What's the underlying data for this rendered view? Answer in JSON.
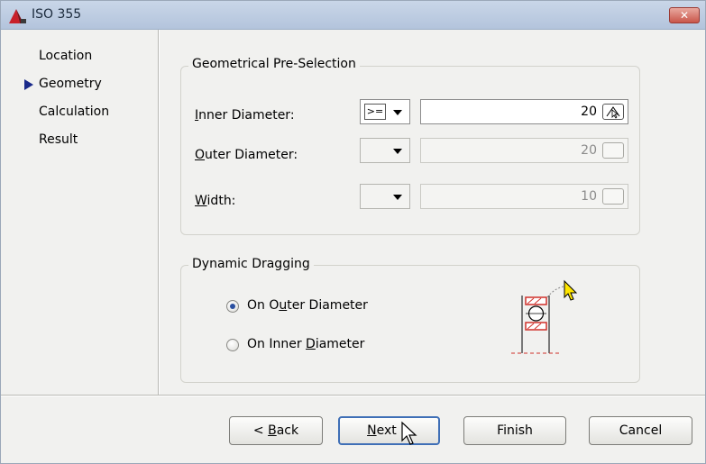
{
  "window": {
    "title": "ISO 355",
    "close_icon": "close-icon"
  },
  "nav": {
    "items": [
      "Location",
      "Geometry",
      "Calculation",
      "Result"
    ],
    "current_index": 1
  },
  "geometry_group": {
    "title": "Geometrical Pre-Selection",
    "rows": [
      {
        "label": "Inner Diameter:",
        "accel": "I",
        "rest": "nner Diameter:",
        "operator": ">=",
        "value": "20",
        "enabled": true
      },
      {
        "label": "Outer Diameter:",
        "accel": "O",
        "rest": "uter Diameter:",
        "operator": "",
        "value": "20",
        "enabled": false
      },
      {
        "label": "Width:",
        "accel": "W",
        "rest": "idth:",
        "operator": "",
        "value": "10",
        "enabled": false
      }
    ]
  },
  "dragging_group": {
    "title": "Dynamic Dragging",
    "options": [
      {
        "label": "On Outer Diameter",
        "pre": "On O",
        "accel": "u",
        "post": "ter Diameter",
        "selected": true
      },
      {
        "label": "On Inner Diameter",
        "pre": "On Inner ",
        "accel": "D",
        "post": "iameter",
        "selected": false
      }
    ]
  },
  "buttons": {
    "back": {
      "pre": "< ",
      "accel": "B",
      "post": "ack"
    },
    "next": {
      "accel": "N",
      "post": "ext >"
    },
    "finish": "Finish",
    "cancel": "Cancel"
  },
  "colors": {
    "accent": "#3f6fb6",
    "nav_arrow": "#1a2a8a",
    "bearing_red": "#d0302a"
  }
}
